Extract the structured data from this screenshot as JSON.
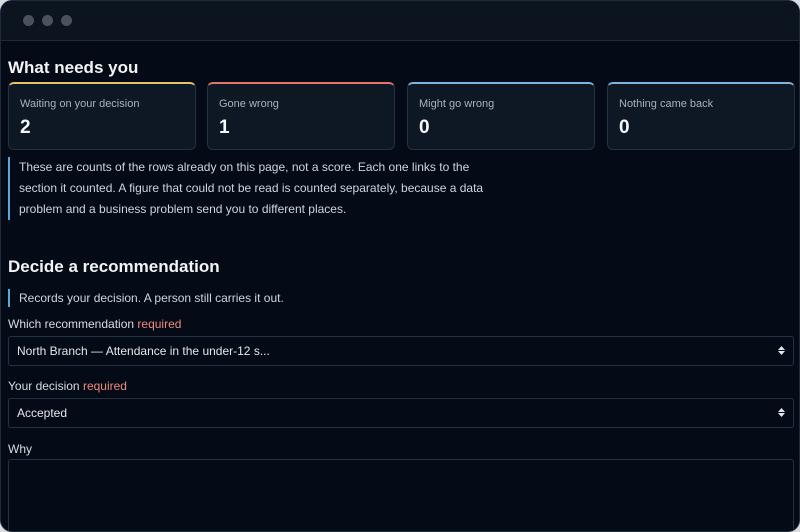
{
  "window": {
    "controls": [
      "close",
      "minimize",
      "zoom"
    ]
  },
  "needs": {
    "heading": "What needs you",
    "cards": [
      {
        "label": "Waiting on your decision",
        "value": "2",
        "accent": "#e6c36a"
      },
      {
        "label": "Gone wrong",
        "value": "1",
        "accent": "#e2766a"
      },
      {
        "label": "Might go wrong",
        "value": "0",
        "accent": "#7fb3e0"
      },
      {
        "label": "Nothing came back",
        "value": "0",
        "accent": "#7fb3e0"
      }
    ],
    "note": "These are counts of the rows already on this page, not a score. Each one links to the section it counted. A figure that could not be read is counted separately, because a data problem and a business problem send you to different places."
  },
  "decide": {
    "heading": "Decide a recommendation",
    "note": "Records your decision. A person still carries it out.",
    "recommendation": {
      "label": "Which recommendation",
      "required": "required",
      "selected": "North Branch — Attendance in the under-12 s..."
    },
    "decision": {
      "label": "Your decision",
      "required": "required",
      "selected": "Accepted"
    },
    "why": {
      "label": "Why",
      "value": ""
    }
  },
  "colors": {
    "background": "#050b16",
    "card_bg": "#0e1724",
    "border": "#243141",
    "note_bar": "#5aa7d8",
    "required": "#ee8a7c"
  }
}
